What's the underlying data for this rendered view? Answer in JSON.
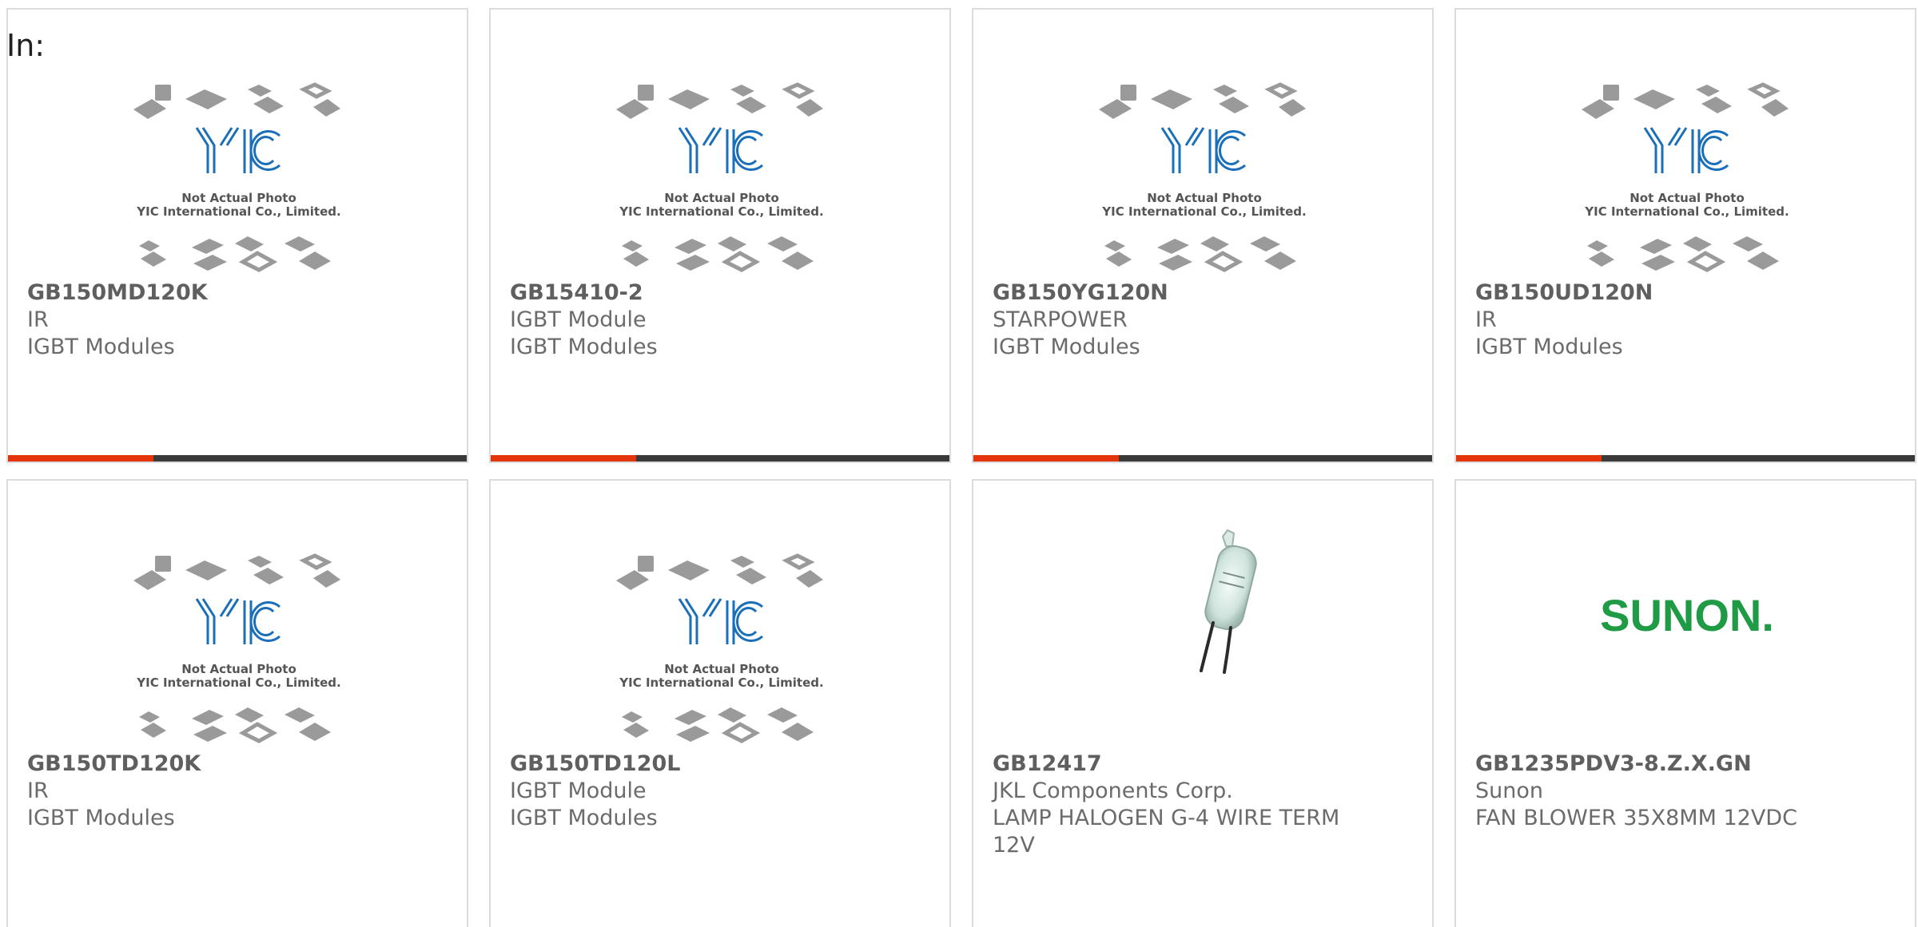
{
  "filter_label": "In:",
  "accent_color": "#e3340c",
  "dark_bar_color": "#3a3a3a",
  "placeholder": {
    "logo": "YIC",
    "line1": "Not Actual Photo",
    "line2": "YIC International Co., Limited."
  },
  "products": [
    {
      "part": "GB150MD120K",
      "mfr": "IR",
      "desc": "IGBT Modules",
      "image": "placeholder"
    },
    {
      "part": "GB15410-2",
      "mfr": "IGBT Module",
      "desc": "IGBT Modules",
      "image": "placeholder"
    },
    {
      "part": "GB150YG120N",
      "mfr": "STARPOWER",
      "desc": "IGBT Modules",
      "image": "placeholder"
    },
    {
      "part": "GB150UD120N",
      "mfr": "IR",
      "desc": "IGBT Modules",
      "image": "placeholder"
    },
    {
      "part": "GB150TD120K",
      "mfr": "IR",
      "desc": "IGBT Modules",
      "image": "placeholder"
    },
    {
      "part": "GB150TD120L",
      "mfr": "IGBT Module",
      "desc": "IGBT Modules",
      "image": "placeholder"
    },
    {
      "part": "GB12417",
      "mfr": "JKL Components Corp.",
      "desc": "LAMP HALOGEN G-4 WIRE TERM 12V",
      "image": "halogen-lamp"
    },
    {
      "part": "GB1235PDV3-8.Z.X.GN",
      "mfr": "Sunon",
      "desc": "FAN BLOWER 35X8MM 12VDC",
      "image": "sunon-logo",
      "brand_text": "SUNON."
    }
  ]
}
